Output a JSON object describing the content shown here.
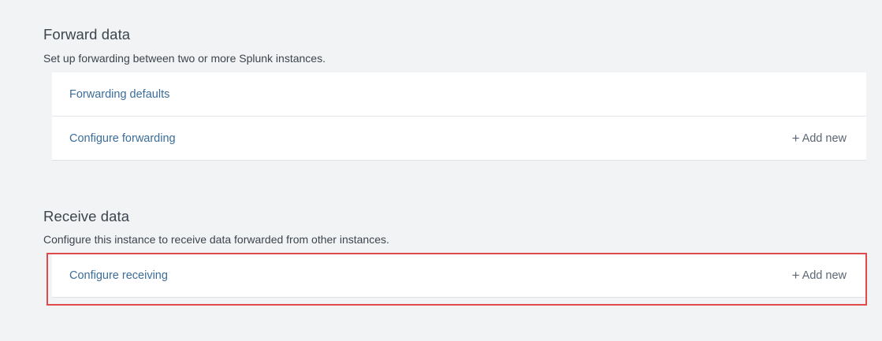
{
  "forward": {
    "title": "Forward data",
    "description": "Set up forwarding between two or more Splunk instances.",
    "rows": [
      {
        "label": "Forwarding defaults",
        "action": ""
      },
      {
        "label": "Configure forwarding",
        "action": "Add new"
      }
    ]
  },
  "receive": {
    "title": "Receive data",
    "description": "Configure this instance to receive data forwarded from other instances.",
    "rows": [
      {
        "label": "Configure receiving",
        "action": "Add new"
      }
    ]
  },
  "icons": {
    "plus": "+"
  },
  "colors": {
    "link": "#3b6d99",
    "highlight": "#e04a4a",
    "background": "#f2f3f5"
  }
}
